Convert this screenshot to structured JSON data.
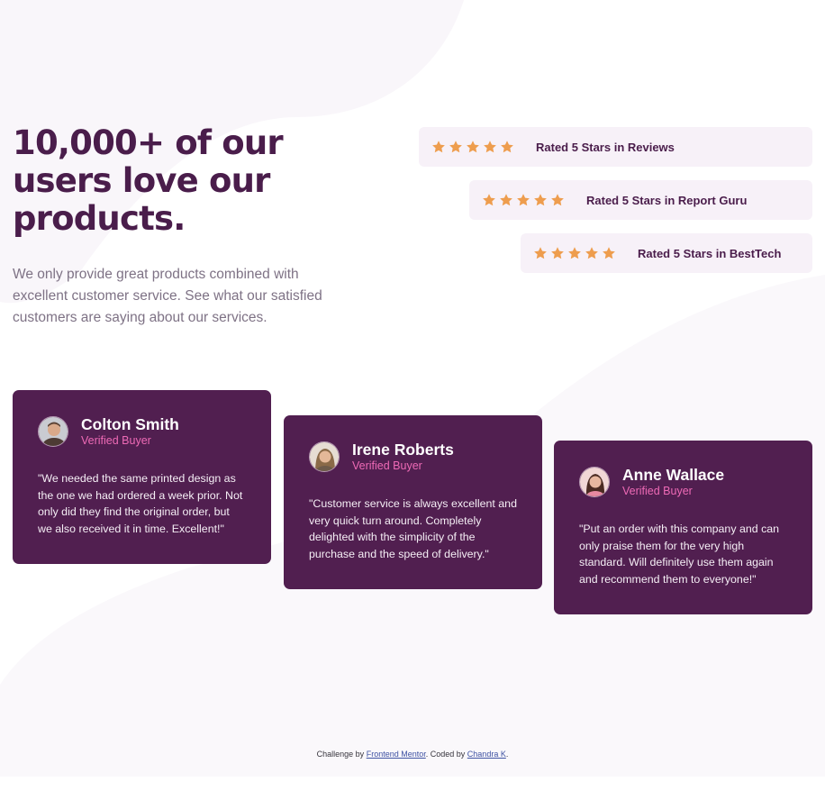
{
  "hero": {
    "title": "10,000+ of our users love our products.",
    "description": "We only provide great products combined with excellent customer service. See what our satisfied customers are saying about our services."
  },
  "ratings": [
    {
      "label": "Rated 5 Stars in Reviews",
      "stars": 5
    },
    {
      "label": "Rated 5 Stars in Report Guru",
      "stars": 5
    },
    {
      "label": "Rated 5 Stars in BestTech",
      "stars": 5
    }
  ],
  "testimonials": [
    {
      "name": "Colton Smith",
      "badge": "Verified Buyer",
      "quote": "\"We needed the same printed design as the one we had ordered a week prior. Not only did they find the original order, but we also received it in time. Excellent!\""
    },
    {
      "name": "Irene Roberts",
      "badge": "Verified Buyer",
      "quote": "\"Customer service is always excellent and very quick turn around. Completely delighted with the simplicity of the purchase and the speed of delivery.\""
    },
    {
      "name": "Anne Wallace",
      "badge": "Verified Buyer",
      "quote": "\"Put an order with this company and can only praise them for the very high standard. Will definitely use them again and recommend them to everyone!\""
    }
  ],
  "footer": {
    "prefix": "Challenge by",
    "challenge_link": "Frontend Mentor",
    "middle": ". Coded by",
    "author_link": "Chandra K",
    "suffix": "."
  },
  "colors": {
    "primary": "#4a1d4b",
    "card_bg": "#511f50",
    "badge": "#ee6ab6",
    "star": "#ee9d4e",
    "rating_bg": "#f7f1f8",
    "body_text": "#7e7285"
  },
  "icons": {
    "star": "star-icon",
    "avatar": "user-avatar"
  }
}
